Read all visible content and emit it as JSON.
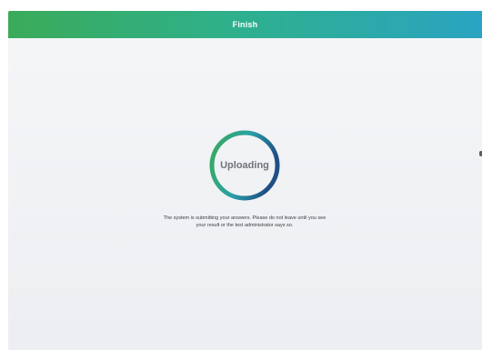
{
  "header": {
    "title": "Finish"
  },
  "upload": {
    "status_label": "Uploading",
    "message": "The system is submitting your answers. Please do not leave until you see your result or the test administrator says so."
  },
  "colors": {
    "header_gradient_start": "#3bab5a",
    "header_gradient_end": "#2aa4c2",
    "ring_start": "#3bab5a",
    "ring_end": "#1f4f86"
  },
  "icons": {
    "spinner": "progress-ring-icon"
  }
}
